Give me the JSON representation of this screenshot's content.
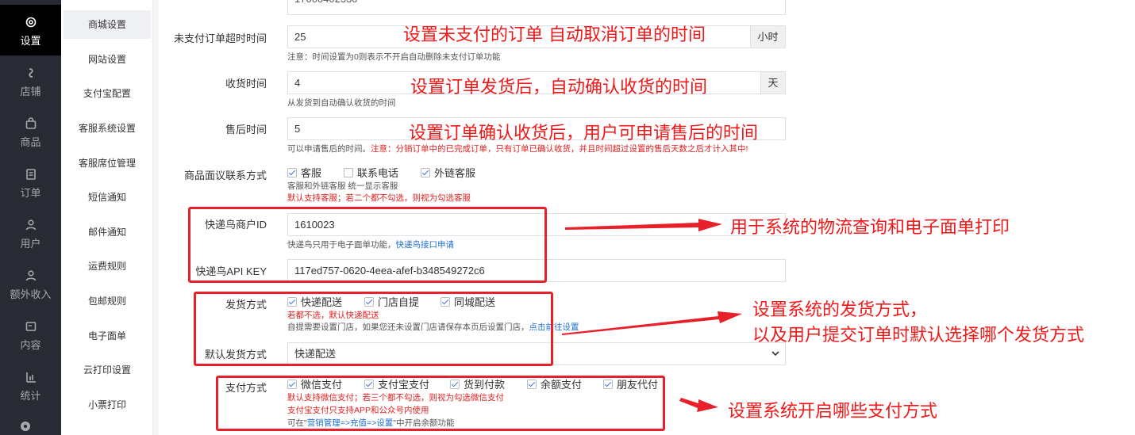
{
  "nav": {
    "items": [
      {
        "label": "设置",
        "icon": "gear-icon",
        "active": true
      },
      {
        "label": "店铺",
        "icon": "store-icon"
      },
      {
        "label": "商品",
        "icon": "bag-icon"
      },
      {
        "label": "订单",
        "icon": "order-icon"
      },
      {
        "label": "用户",
        "icon": "user-icon"
      },
      {
        "label": "额外收入",
        "icon": "income-icon"
      },
      {
        "label": "内容",
        "icon": "content-icon"
      },
      {
        "label": "统计",
        "icon": "chart-icon"
      }
    ]
  },
  "submenu": {
    "items": [
      "商城设置",
      "网站设置",
      "支付宝配置",
      "客服系统设置",
      "客服席位管理",
      "短信通知",
      "邮件通知",
      "运费规则",
      "包邮规则",
      "电子面单",
      "云打印设置",
      "小票打印"
    ]
  },
  "form": {
    "top_partial_value": "17000402330",
    "unpaid_timeout": {
      "label": "未支付订单超时时间",
      "value": "25",
      "addon": "小时",
      "hint": "注意：时间设置为0则表示不开启自动删除未支付订单功能"
    },
    "receive_time": {
      "label": "收货时间",
      "value": "4",
      "addon": "天",
      "hint": "从发货到自动确认收货的时间"
    },
    "aftersale_time": {
      "label": "售后时间",
      "value": "5",
      "hint_a": "可以申请售后的时间。",
      "hint_b": "注意：分销订单中的已完成订单，只有订单已确认收货，并且时间超过设置的售后天数之后才计入其中!"
    },
    "contact": {
      "label": "商品面议联系方式",
      "options": [
        {
          "label": "客服",
          "checked": true
        },
        {
          "label": "联系电话",
          "checked": false
        },
        {
          "label": "外链客服",
          "checked": true
        }
      ],
      "hint": "客服和外链客服 统一显示客服",
      "hint_red": "默认支持客服；若二个都不勾选，则视为勾选客服"
    },
    "kdn_id": {
      "label": "快递鸟商户ID",
      "value": "1610023",
      "hint": "快递鸟只用于电子面单功能，",
      "link": "快递鸟接口申请"
    },
    "kdn_key": {
      "label": "快递鸟API KEY",
      "value": "117ed757-0620-4eea-afef-b348549272c6"
    },
    "delivery": {
      "label": "发货方式",
      "options": [
        {
          "label": "快递配送",
          "checked": true
        },
        {
          "label": "门店自提",
          "checked": true
        },
        {
          "label": "同城配送",
          "checked": true
        }
      ],
      "hint_red": "若都不选，默认快递配送",
      "hint": "自提需要设置门店，如果您还未设置门店请保存本页后设置门店，",
      "link": "点击前往设置"
    },
    "default_delivery": {
      "label": "默认发货方式",
      "value": "快递配送"
    },
    "payment": {
      "label": "支付方式",
      "options": [
        {
          "label": "微信支付",
          "checked": true
        },
        {
          "label": "支付宝支付",
          "checked": true
        },
        {
          "label": "货到付款",
          "checked": true
        },
        {
          "label": "余额支付",
          "checked": true
        },
        {
          "label": "朋友代付",
          "checked": true
        }
      ],
      "hint_red1": "默认支持微信支付；若三个都不勾选，则视为勾选微信支付",
      "hint_red2": "支付宝支付只支持APP和公众号内使用",
      "hint_pre": "可在\"",
      "link": "营销管理=>充值=>设置",
      "hint_post": "\"中开启余额功能"
    }
  },
  "annotations": {
    "a1": "设置未支付的订单 自动取消订单的时间",
    "a2": "设置订单发货后，自动确认收货的时间",
    "a3": "设置订单确认收货后，用户可申请售后的时间",
    "a4": "用于系统的物流查询和电子面单打印",
    "a5_line1": "设置系统的发货方式，",
    "a5_line2": "以及用户提交订单时默认选择哪个发货方式",
    "a6": "设置系统开启哪些支付方式",
    "color": "#f01818"
  }
}
